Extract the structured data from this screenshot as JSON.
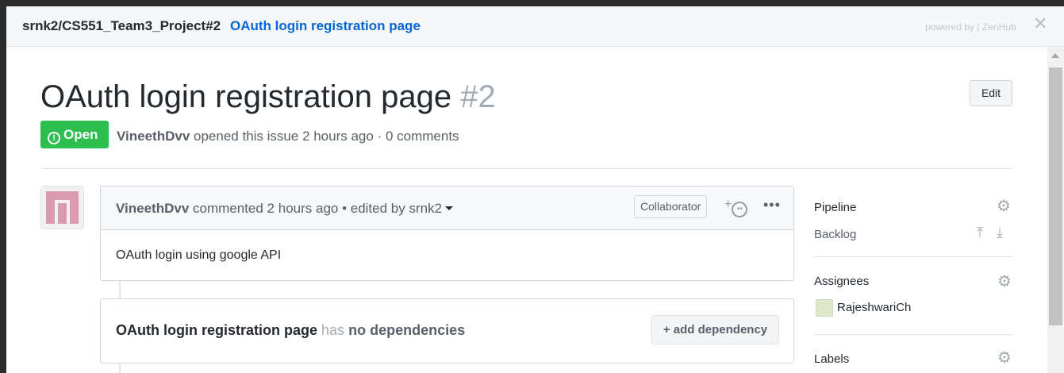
{
  "header": {
    "repo": "srnk2/CS551_Team3_Project#2",
    "issue_link": "OAuth login registration page",
    "powered_by": "powered by | ZenHub",
    "close_icon": "close-icon"
  },
  "issue": {
    "title": "OAuth login registration page",
    "number": "#2",
    "edit_label": "Edit",
    "status": "Open",
    "author": "VineethDvv",
    "meta_rest": "opened this issue 2 hours ago · 0 comments"
  },
  "comment": {
    "author": "VineethDvv",
    "meta_rest": "commented 2 hours ago • edited by srnk2",
    "role_badge": "Collaborator",
    "reaction_plus": "+",
    "more": "•••",
    "body": "OAuth login using google API"
  },
  "dependencies": {
    "issue_name": "OAuth login registration page",
    "has": "has",
    "status": "no dependencies",
    "add_label": "+ add dependency"
  },
  "sidebar": {
    "pipeline_label": "Pipeline",
    "pipeline_value": "Backlog",
    "assignees_label": "Assignees",
    "assignee_name": "RajeshwariCh",
    "labels_label": "Labels"
  },
  "colors": {
    "open_green": "#2cbe4e",
    "link_blue": "#0366d6"
  }
}
